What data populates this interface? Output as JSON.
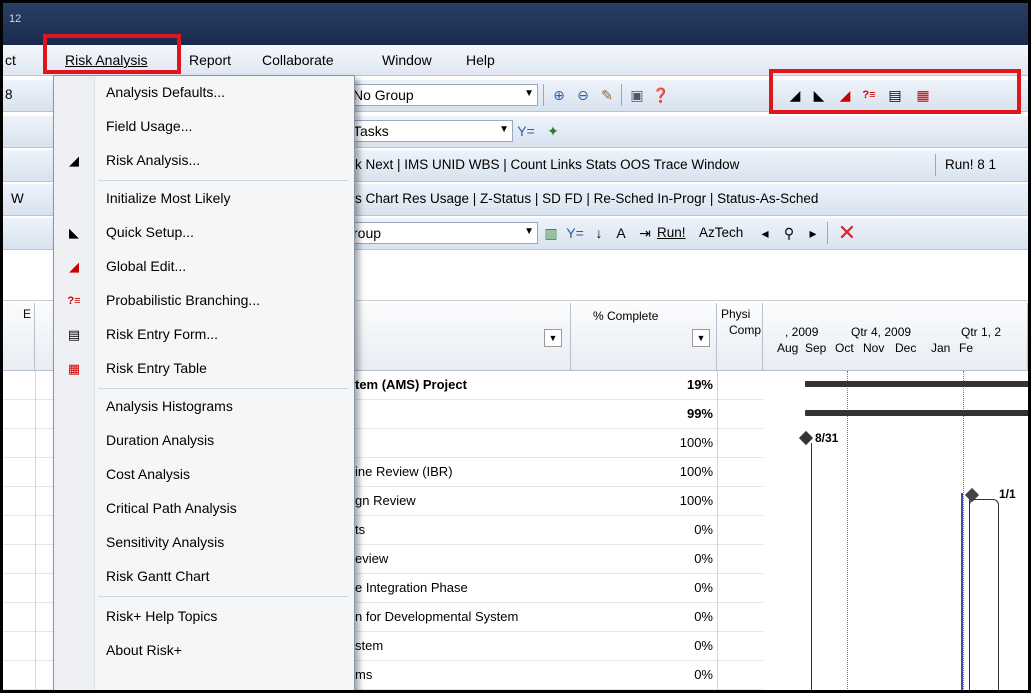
{
  "menubar": {
    "items": [
      {
        "label": "ct"
      },
      {
        "label": "Risk Analysis"
      },
      {
        "label": "Report"
      },
      {
        "label": "Collaborate"
      },
      {
        "label": "Window"
      },
      {
        "label": "Help"
      }
    ]
  },
  "toolbar1": {
    "group_combo": "No Group",
    "left_value": "8"
  },
  "toolbar2": {
    "filter_combo": "Tasks"
  },
  "toolbar3": {
    "text": "k  Next | IMS  UNID  WBS | Count  Links  Stats  OOS  Trace  Window",
    "run": "Run!  8  1"
  },
  "toolbar4": {
    "left": "W",
    "text": "s Chart  Res Usage | Z-Status | SD  FD | Re-Sched In-Progr | Status-As-Sched"
  },
  "toolbar5": {
    "group_combo": "roup",
    "run": "Run!",
    "aztech": "AzTech"
  },
  "grid": {
    "col_pct": "% Complete",
    "col_phys": "Physi",
    "col_phys2": "Comp",
    "left_hdr": "E",
    "timeline": {
      "top": [
        ", 2009",
        "Qtr 4, 2009",
        "Qtr 1, 2"
      ],
      "bottom": [
        "Aug",
        "Sep",
        "Oct",
        "Nov",
        "Dec",
        "Jan",
        "Fe"
      ]
    },
    "rows": [
      {
        "name": "tem (AMS) Project",
        "pct": "19%",
        "bold": true
      },
      {
        "name": "",
        "pct": "99%",
        "bold": true
      },
      {
        "name": "",
        "pct": "100%",
        "bold": false
      },
      {
        "name": "ine Review (IBR)",
        "pct": "100%",
        "bold": false
      },
      {
        "name": "gn Review",
        "pct": "100%",
        "bold": false
      },
      {
        "name": "ts",
        "pct": "0%",
        "bold": false
      },
      {
        "name": "eview",
        "pct": "0%",
        "bold": false
      },
      {
        "name": "e Integration Phase",
        "pct": "0%",
        "bold": false
      },
      {
        "name": "n for Developmental System",
        "pct": "0%",
        "bold": false
      },
      {
        "name": "stem",
        "pct": "0%",
        "bold": false
      },
      {
        "name": "ms",
        "pct": "0%",
        "bold": false
      }
    ],
    "milestone1": "8/31",
    "milestone2": "1/1"
  },
  "risk_menu": {
    "items": [
      {
        "label": "Analysis Defaults...",
        "icon": ""
      },
      {
        "label": "Field Usage...",
        "icon": ""
      },
      {
        "label": "Risk Analysis...",
        "icon": "risk-analysis-icon"
      },
      {
        "label": "Initialize Most Likely",
        "icon": ""
      },
      {
        "label": "Quick Setup...",
        "icon": "quick-setup-icon"
      },
      {
        "label": "Global Edit...",
        "icon": "global-edit-icon"
      },
      {
        "label": "Probabilistic Branching...",
        "icon": "branching-icon"
      },
      {
        "label": "Risk Entry Form...",
        "icon": "risk-entry-form-icon"
      },
      {
        "label": "Risk Entry Table",
        "icon": "risk-entry-table-icon"
      },
      {
        "label": "Analysis Histograms",
        "icon": ""
      },
      {
        "label": "Duration Analysis",
        "icon": ""
      },
      {
        "label": "Cost Analysis",
        "icon": ""
      },
      {
        "label": "Critical Path Analysis",
        "icon": ""
      },
      {
        "label": "Sensitivity Analysis",
        "icon": ""
      },
      {
        "label": "Risk Gantt Chart",
        "icon": ""
      },
      {
        "label": "Risk+ Help Topics",
        "icon": ""
      },
      {
        "label": "About Risk+",
        "icon": ""
      }
    ]
  },
  "colors": {
    "highlight": "#e0161d",
    "title": "#1a2a4d"
  }
}
